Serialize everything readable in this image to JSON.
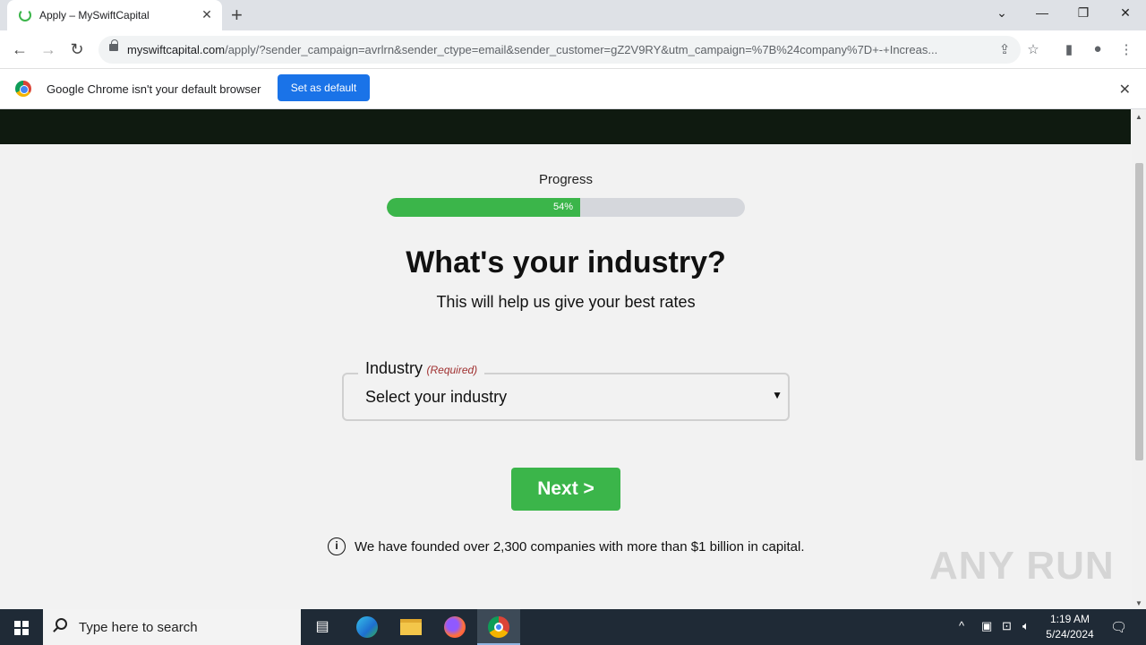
{
  "browser": {
    "tab_title": "Apply – MySwiftCapital",
    "url_host": "myswiftcapital.com",
    "url_rest": "/apply/?sender_campaign=avrlrn&sender_ctype=email&sender_customer=gZ2V9RY&utm_campaign=%7B%24company%7D+-+Increas...",
    "infobar_message": "Google Chrome isn't your default browser",
    "infobar_button": "Set as default"
  },
  "page": {
    "progress_label": "Progress",
    "progress_percent": 54,
    "progress_text": "54%",
    "heading": "What's your industry?",
    "subheading": "This will help us give your best rates",
    "field_label": "Industry",
    "field_required": "(Required)",
    "field_value": "Select your industry",
    "next_label": "Next >",
    "note": "We have founded over 2,300 companies with more than $1 billion in capital.",
    "watermark": "ANY RUN"
  },
  "taskbar": {
    "search_placeholder": "Type here to search",
    "time": "1:19 AM",
    "date": "5/24/2024"
  },
  "colors": {
    "accent_green": "#3bb54a",
    "header_dark": "#0f1a10",
    "chrome_blue": "#1a73e8"
  }
}
